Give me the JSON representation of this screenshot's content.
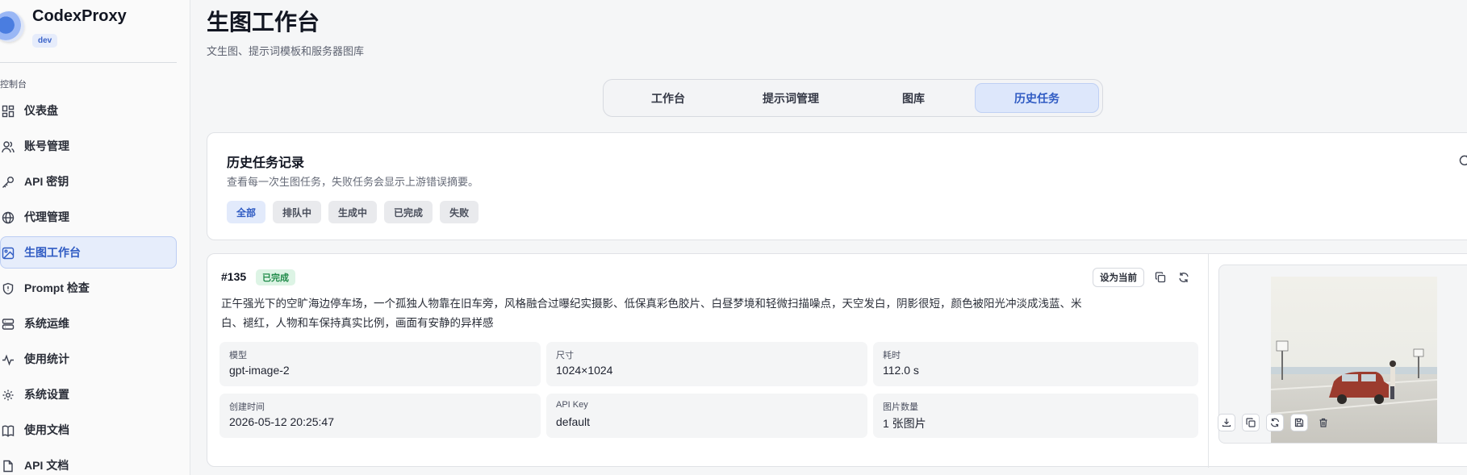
{
  "brand": {
    "name": "CodexProxy",
    "badge": "dev"
  },
  "sidebar": {
    "group_label": "控制台",
    "items": [
      {
        "label": "仪表盘",
        "icon": "dashboard-icon",
        "active": false
      },
      {
        "label": "账号管理",
        "icon": "users-icon",
        "active": false
      },
      {
        "label": "API 密钥",
        "icon": "key-icon",
        "active": false
      },
      {
        "label": "代理管理",
        "icon": "globe-icon",
        "active": false
      },
      {
        "label": "生图工作台",
        "icon": "image-icon",
        "active": true
      },
      {
        "label": "Prompt 检查",
        "icon": "shield-icon",
        "active": false
      },
      {
        "label": "系统运维",
        "icon": "server-icon",
        "active": false
      },
      {
        "label": "使用统计",
        "icon": "activity-icon",
        "active": false
      },
      {
        "label": "系统设置",
        "icon": "gear-icon",
        "active": false
      },
      {
        "label": "使用文档",
        "icon": "book-icon",
        "active": false
      },
      {
        "label": "API 文档",
        "icon": "doc-icon",
        "active": false
      }
    ]
  },
  "header": {
    "title": "生图工作台",
    "subtitle": "文生图、提示词模板和服务器图库"
  },
  "tabs": [
    {
      "label": "工作台",
      "active": false
    },
    {
      "label": "提示词管理",
      "active": false
    },
    {
      "label": "图库",
      "active": false
    },
    {
      "label": "历史任务",
      "active": true
    }
  ],
  "history": {
    "title": "历史任务记录",
    "description": "查看每一次生图任务，失败任务会显示上游错误摘要。",
    "filters": [
      {
        "label": "全部",
        "active": true
      },
      {
        "label": "排队中",
        "active": false
      },
      {
        "label": "生成中",
        "active": false
      },
      {
        "label": "已完成",
        "active": false
      },
      {
        "label": "失败",
        "active": false
      }
    ]
  },
  "task": {
    "id": "#135",
    "status": "已完成",
    "status_color": "#1f8a48",
    "prompt": "正午强光下的空旷海边停车场，一个孤独人物靠在旧车旁，风格融合过曝纪实摄影、低保真彩色胶片、白昼梦境和轻微扫描噪点，天空发白，阴影很短，颜色被阳光冲淡成浅蓝、米白、褪红，人物和车保持真实比例，画面有安静的异样感",
    "set_current_label": "设为当前",
    "meta": [
      {
        "label": "模型",
        "value": "gpt-image-2"
      },
      {
        "label": "尺寸",
        "value": "1024×1024"
      },
      {
        "label": "耗时",
        "value": "112.0 s"
      },
      {
        "label": "创建时间",
        "value": "2026-05-12 20:25:47"
      },
      {
        "label": "API Key",
        "value": "default"
      },
      {
        "label": "图片数量",
        "value": "1 张图片"
      }
    ]
  },
  "colors": {
    "accent": "#2f5bc3",
    "accent_bg": "#e6edfb",
    "success": "#1f8a48"
  }
}
